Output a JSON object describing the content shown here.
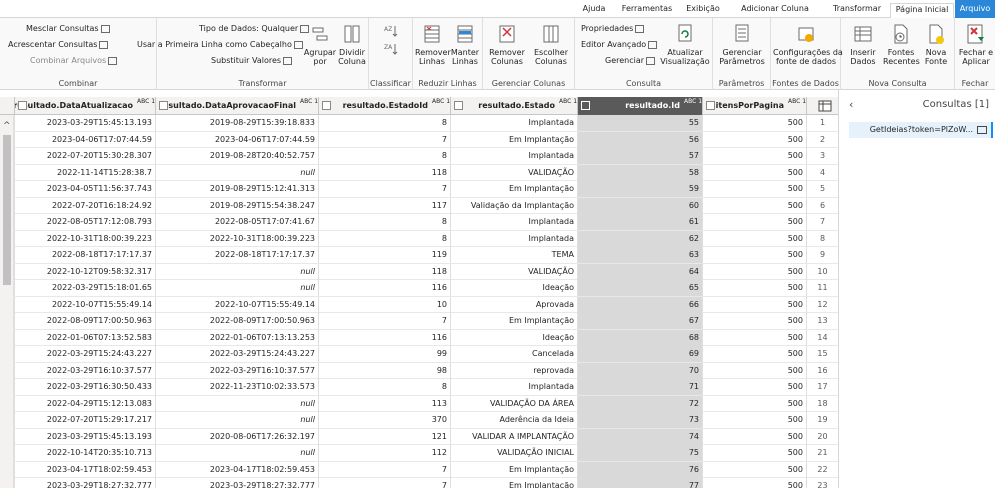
{
  "tabs": [
    "Arquivo",
    "Página Inicial",
    "Transformar",
    "Adicionar Coluna",
    "Exibição",
    "Ferramentas",
    "Ajuda"
  ],
  "ribbon": {
    "close": {
      "label1": "Fechar e",
      "label2": "Aplicar",
      "group": "Fechar"
    },
    "newquery": {
      "b1": "Nova",
      "b1b": "Fonte",
      "b2": "Fontes",
      "b2b": "Recentes",
      "b3": "Inserir",
      "b3b": "Dados",
      "group": "Nova Consulta"
    },
    "datasources": {
      "b1": "Configurações da",
      "b1b": "fonte de dados",
      "group": "Fontes de Dados"
    },
    "params": {
      "b1": "Gerenciar",
      "b1b": "Parâmetros",
      "group": "Parâmetros"
    },
    "query": {
      "refresh1": "Atualizar",
      "refresh2": "Visualização",
      "props": "Propriedades",
      "editor": "Editor Avançado",
      "manage": "Gerenciar",
      "group": "Consulta"
    },
    "columns": {
      "b1": "Escolher",
      "b1b": "Colunas",
      "b2": "Remover",
      "b2b": "Colunas",
      "group": "Gerenciar Colunas"
    },
    "rows": {
      "b1": "Manter",
      "b1b": "Linhas",
      "b2": "Remover",
      "b2b": "Linhas",
      "group": "Reduzir Linhas"
    },
    "sort": {
      "group": "Classificar"
    },
    "transform": {
      "split1": "Dividir",
      "split2": "Coluna",
      "group1": "Agrupar",
      "group2": "por",
      "dtype": "Tipo de Dados: Qualquer",
      "header": "Usar a Primeira Linha como Cabeçalho",
      "replace": "Substituir Valores",
      "group": "Transformar"
    },
    "combine": {
      "merge": "Mesclar Consultas",
      "append": "Acrescentar Consultas",
      "files": "Combinar Arquivos",
      "group": "Combinar"
    }
  },
  "queries": {
    "title": "Consultas [1]",
    "item": "GetIdeias?token=PlZoW..."
  },
  "columns": [
    {
      "type": "ABC 123",
      "name": "itensPorPagina"
    },
    {
      "type": "ABC 123",
      "name": "resultado.Id"
    },
    {
      "type": "ABC 123",
      "name": "resultado.Estado"
    },
    {
      "type": "ABC 123",
      "name": "resultado.EstadoId"
    },
    {
      "type": "ABC 123",
      "name": "resultado.DataAprovacaoFinal"
    },
    {
      "type": "ABC 123",
      "name": "resultado.DataAtualizacao"
    }
  ],
  "rows": [
    [
      "1",
      "500",
      "55",
      "Implantada",
      "8",
      "2019-08-29T15:39:18.833",
      "2023-03-29T15:45:13.193"
    ],
    [
      "2",
      "500",
      "56",
      "Em Implantação",
      "7",
      "2023-04-06T17:07:44.59",
      "2023-04-06T17:07:44.59"
    ],
    [
      "3",
      "500",
      "57",
      "Implantada",
      "8",
      "2019-08-28T20:40:52.757",
      "2022-07-20T15:30:28.307"
    ],
    [
      "4",
      "500",
      "58",
      "VALIDAÇÃO",
      "118",
      "null",
      "2022-11-14T15:28:38.7"
    ],
    [
      "5",
      "500",
      "59",
      "Em Implantação",
      "7",
      "2019-08-29T15:12:41.313",
      "2023-04-05T11:56:37.743"
    ],
    [
      "6",
      "500",
      "60",
      "Validação da Implantação",
      "117",
      "2019-08-29T15:54:38.247",
      "2022-07-20T16:18:24.92"
    ],
    [
      "7",
      "500",
      "61",
      "Implantada",
      "8",
      "2022-08-05T17:07:41.67",
      "2022-08-05T17:12:08.793"
    ],
    [
      "8",
      "500",
      "62",
      "Implantada",
      "8",
      "2022-10-31T18:00:39.223",
      "2022-10-31T18:00:39.223"
    ],
    [
      "9",
      "500",
      "63",
      "TEMA",
      "119",
      "2022-08-18T17:17:17.37",
      "2022-08-18T17:17:17.37"
    ],
    [
      "10",
      "500",
      "64",
      "VALIDAÇÃO",
      "118",
      "null",
      "2022-10-12T09:58:32.317"
    ],
    [
      "11",
      "500",
      "65",
      "Ideação",
      "116",
      "null",
      "2022-03-29T15:18:01.65"
    ],
    [
      "12",
      "500",
      "66",
      "Aprovada",
      "10",
      "2022-10-07T15:55:49.14",
      "2022-10-07T15:55:49.14"
    ],
    [
      "13",
      "500",
      "67",
      "Em Implantação",
      "7",
      "2022-08-09T17:00:50.963",
      "2022-08-09T17:00:50.963"
    ],
    [
      "14",
      "500",
      "68",
      "Ideação",
      "116",
      "2022-01-06T07:13:13.253",
      "2022-01-06T07:13:52.583"
    ],
    [
      "15",
      "500",
      "69",
      "Cancelada",
      "99",
      "2022-03-29T15:24:43.227",
      "2022-03-29T15:24:43.227"
    ],
    [
      "16",
      "500",
      "70",
      "reprovada",
      "98",
      "2022-03-29T16:10:37.577",
      "2022-03-29T16:10:37.577"
    ],
    [
      "17",
      "500",
      "71",
      "Implantada",
      "8",
      "2022-11-23T10:02:33.573",
      "2022-03-29T16:30:50.433"
    ],
    [
      "18",
      "500",
      "72",
      "VALIDAÇÃO DA ÁREA",
      "113",
      "null",
      "2022-04-29T15:12:13.083"
    ],
    [
      "19",
      "500",
      "73",
      "Aderência da Ideia",
      "370",
      "null",
      "2022-07-20T15:29:17.217"
    ],
    [
      "20",
      "500",
      "74",
      "VALIDAR A IMPLANTAÇÃO",
      "121",
      "2020-08-06T17:26:32.197",
      "2023-03-29T15:45:13.193"
    ],
    [
      "21",
      "500",
      "75",
      "VALIDAÇÃO INICIAL",
      "112",
      "null",
      "2022-10-14T20:35:10.713"
    ],
    [
      "22",
      "500",
      "76",
      "Em Implantação",
      "7",
      "2023-04-17T18:02:59.453",
      "2023-04-17T18:02:59.453"
    ],
    [
      "23",
      "500",
      "77",
      "Em Implantação",
      "7",
      "2023-03-29T18:27:32.777",
      "2023-03-29T18:27:32.777"
    ]
  ]
}
